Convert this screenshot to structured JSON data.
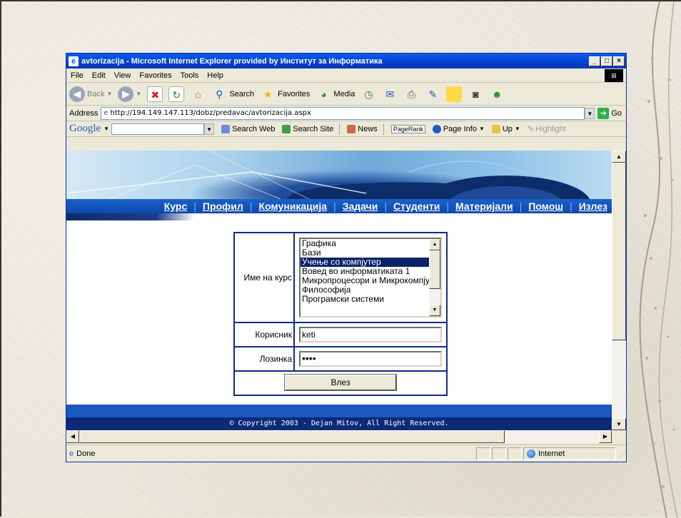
{
  "window": {
    "title": "avtorizacija - Microsoft Internet Explorer provided by Институт за Информатика",
    "buttons": [
      "_",
      "□",
      "×"
    ]
  },
  "menu": [
    "File",
    "Edit",
    "View",
    "Favorites",
    "Tools",
    "Help"
  ],
  "toolbar": {
    "back": "Back",
    "search": "Search",
    "favorites": "Favorites",
    "media": "Media"
  },
  "address": {
    "label": "Address",
    "url": "http://194.149.147.113/dobz/predavac/avtorizacija.aspx",
    "go": "Go"
  },
  "googlebar": {
    "logo": "Google",
    "search_web": "Search Web",
    "search_site": "Search Site",
    "news": "News",
    "pagerank": "PageRank",
    "page_info": "Page Info",
    "up": "Up",
    "highlight": "Highlight"
  },
  "nav": {
    "links": [
      "Курс",
      "Профил",
      "Комуникација",
      "Задачи",
      "Студенти",
      "Материјали",
      "Помош",
      "Излез"
    ]
  },
  "login": {
    "course_label": "Име на курс",
    "courses": [
      "Графика",
      "Бази",
      "Учење со компјутер",
      "Вовед во информатиката 1",
      "Микропроцесори и Микрокомпјутери",
      "Философија",
      "Програмски системи"
    ],
    "selected_course": "Учење со компјутер",
    "user_label": "Корисник",
    "user_value": "keti",
    "password_label": "Лозинка",
    "password_value": "••••",
    "submit_label": "Влез"
  },
  "footer": {
    "copyright": "© Copyright 2003 - Dejan Mitov, All Right Reserved."
  },
  "status": {
    "text": "Done",
    "zone": "Internet"
  },
  "colors": {
    "nav_blue": "#1c61c9",
    "table_border": "#0e2a8c",
    "selection": "#0a246a",
    "footer_dark": "#0b2a78"
  }
}
